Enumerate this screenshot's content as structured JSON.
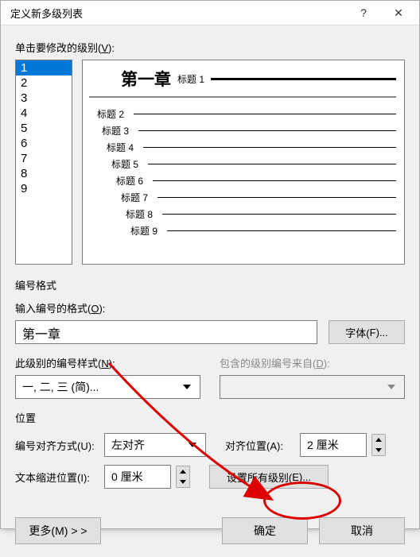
{
  "titlebar": {
    "title": "定义新多级列表"
  },
  "level_section_label": {
    "prefix": "单击要修改的级别(",
    "key": "V",
    "suffix": "):"
  },
  "levels": [
    "1",
    "2",
    "3",
    "4",
    "5",
    "6",
    "7",
    "8",
    "9"
  ],
  "selected_level": 0,
  "preview": {
    "first_number": "第一章",
    "first_label": "标题 1",
    "rows": [
      "标题 2",
      "标题 3",
      "标题 4",
      "标题 5",
      "标题 6",
      "标题 7",
      "标题 8",
      "标题 9"
    ]
  },
  "numfmt": {
    "section_title": "编号格式",
    "format_label": {
      "prefix": "输入编号的格式(",
      "key": "O",
      "suffix": "):"
    },
    "format_value": "第一章",
    "font_btn": {
      "prefix": "字体(",
      "key": "F",
      "suffix": ")..."
    },
    "style_label": {
      "prefix": "此级别的编号样式(",
      "key": "N",
      "suffix": "):"
    },
    "style_value": "一, 二, 三 (简)...",
    "include_label": {
      "prefix": "包含的级别编号来自(",
      "key": "D",
      "suffix": "):"
    },
    "include_value": ""
  },
  "position": {
    "section_title": "位置",
    "align_label": {
      "prefix": "编号对齐方式(",
      "key": "U",
      "suffix": "):"
    },
    "align_value": "左对齐",
    "alignpos_label": {
      "prefix": "对齐位置(",
      "key": "A",
      "suffix": "):"
    },
    "alignpos_value": "2 厘米",
    "indent_label": {
      "prefix": "文本缩进位置(",
      "key": "I",
      "suffix": "):"
    },
    "indent_value": "0 厘米",
    "setall_btn": {
      "prefix": "设置所有级别(",
      "key": "E",
      "suffix": ")..."
    }
  },
  "bottom": {
    "more_btn": {
      "prefix": "更多(",
      "key": "M",
      "suffix": ") > >"
    },
    "ok_btn": "确定",
    "cancel_btn": "取消"
  },
  "chart_data": null
}
